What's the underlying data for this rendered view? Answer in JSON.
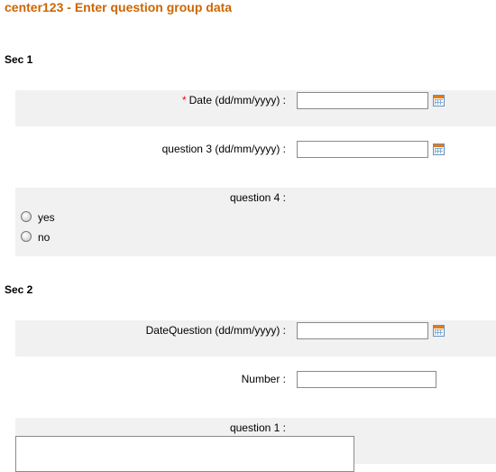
{
  "page": {
    "title": "center123 - Enter question group data"
  },
  "sections": [
    {
      "heading": "Sec 1",
      "questions": [
        {
          "required_marker": "*",
          "label": "Date (dd/mm/yyyy) :",
          "value": "",
          "icon": "calendar-icon"
        },
        {
          "label": "question 3 (dd/mm/yyyy) :",
          "value": "",
          "icon": "calendar-icon"
        },
        {
          "label": "question 4 :",
          "options": [
            "yes",
            "no"
          ],
          "selected": ""
        }
      ]
    },
    {
      "heading": "Sec 2",
      "questions": [
        {
          "label": "DateQuestion (dd/mm/yyyy) :",
          "value": "",
          "icon": "calendar-icon"
        },
        {
          "label": "Number :",
          "value": ""
        },
        {
          "label": "question 1 :",
          "value": ""
        }
      ]
    }
  ],
  "colors": {
    "title": "#cc6600",
    "required": "#ff0000",
    "row_shade": "#f1f1f1"
  }
}
